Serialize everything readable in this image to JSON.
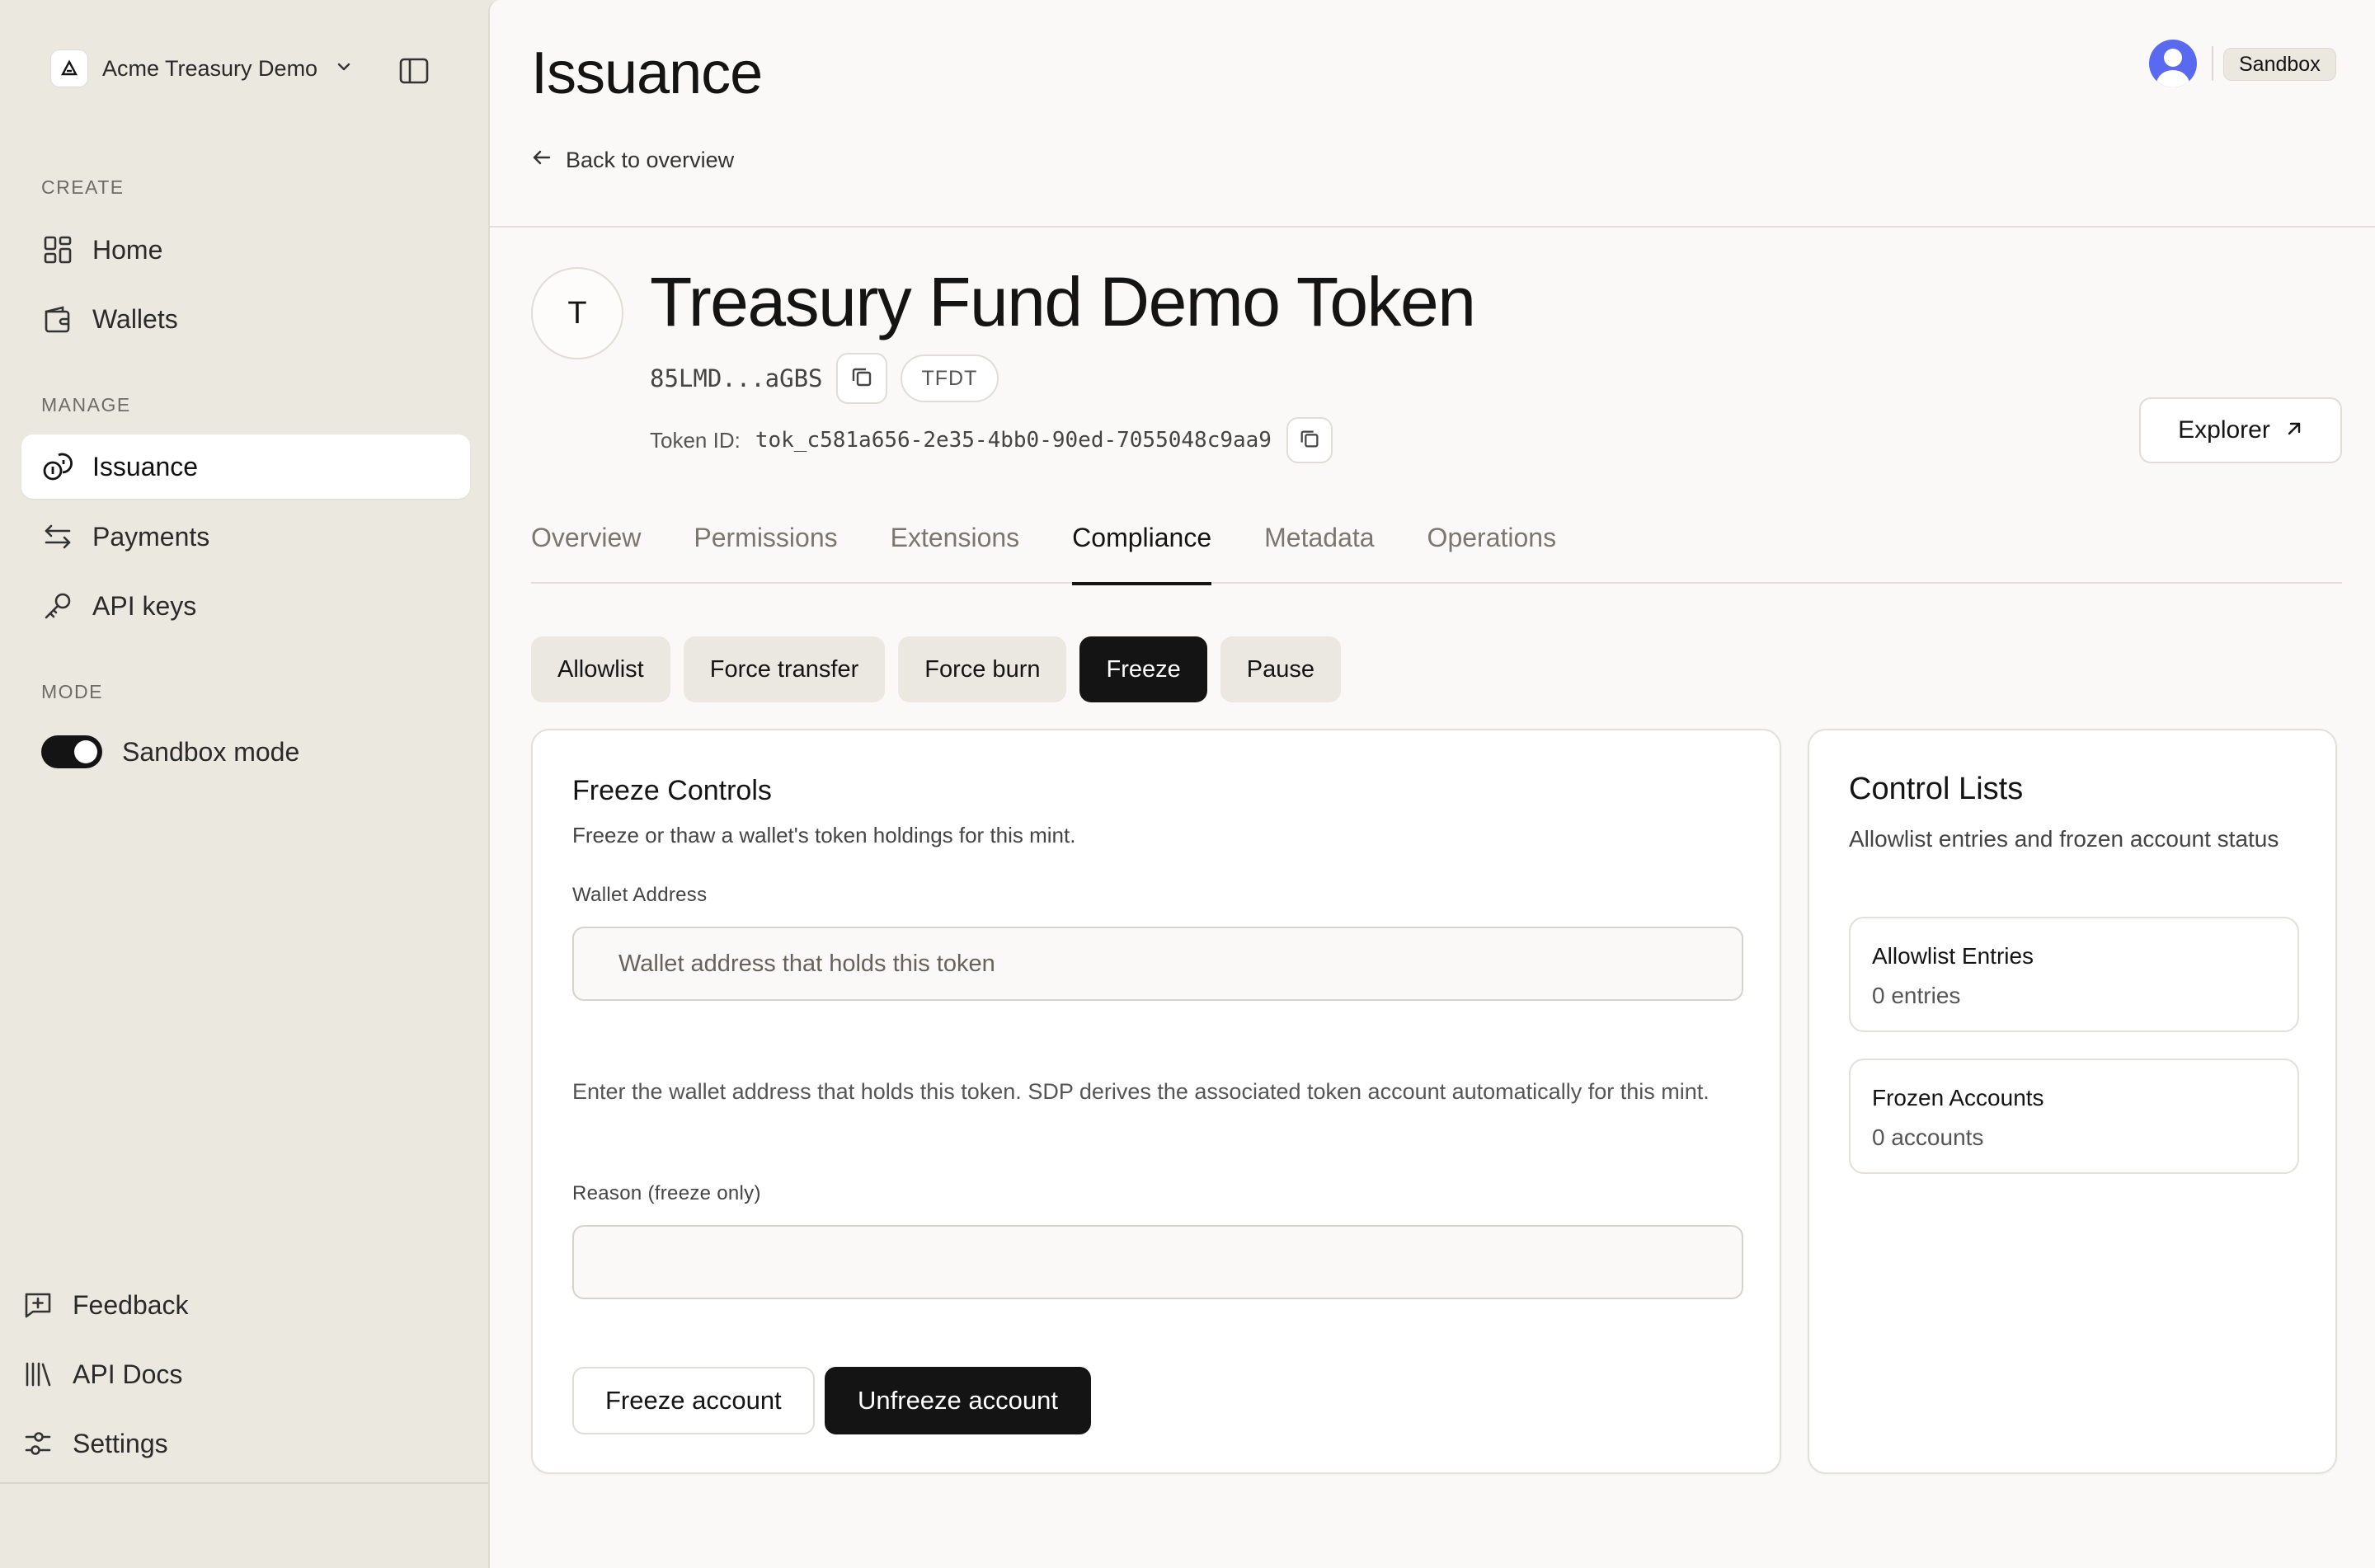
{
  "workspace": {
    "name": "Acme Treasury Demo"
  },
  "sidebar": {
    "sections": [
      {
        "label": "CREATE"
      },
      {
        "label": "MANAGE"
      },
      {
        "label": "MODE"
      }
    ],
    "items": [
      {
        "label": "Home",
        "icon": "grid-icon"
      },
      {
        "label": "Wallets",
        "icon": "wallet-icon"
      },
      {
        "label": "Issuance",
        "icon": "coins-icon",
        "active": true
      },
      {
        "label": "Payments",
        "icon": "arrows-icon"
      },
      {
        "label": "API keys",
        "icon": "key-icon"
      }
    ],
    "mode_toggle": {
      "label": "Sandbox mode",
      "on": true
    },
    "bottom": [
      {
        "label": "Feedback",
        "icon": "feedback-icon"
      },
      {
        "label": "API Docs",
        "icon": "library-icon"
      },
      {
        "label": "Settings",
        "icon": "sliders-icon"
      }
    ]
  },
  "header": {
    "title": "Issuance",
    "back_label": "Back to overview",
    "env_badge": "Sandbox"
  },
  "token": {
    "initial": "T",
    "name": "Treasury Fund Demo Token",
    "address_short": "85LMD...aGBS",
    "symbol": "TFDT",
    "id_label": "Token ID:",
    "id_value": "tok_c581a656-2e35-4bb0-90ed-7055048c9aa9",
    "explorer_label": "Explorer"
  },
  "tabs": [
    {
      "label": "Overview"
    },
    {
      "label": "Permissions"
    },
    {
      "label": "Extensions"
    },
    {
      "label": "Compliance",
      "active": true
    },
    {
      "label": "Metadata"
    },
    {
      "label": "Operations"
    }
  ],
  "compliance_actions": [
    {
      "label": "Allowlist"
    },
    {
      "label": "Force transfer"
    },
    {
      "label": "Force burn"
    },
    {
      "label": "Freeze",
      "active": true
    },
    {
      "label": "Pause"
    }
  ],
  "freeze_card": {
    "title": "Freeze Controls",
    "subtitle": "Freeze or thaw a wallet's token holdings for this mint.",
    "wallet_label": "Wallet Address",
    "wallet_placeholder": "Wallet address that holds this token",
    "wallet_value": "",
    "help_text": "Enter the wallet address that holds this token. SDP derives the associated token account automatically for this mint.",
    "reason_label": "Reason (freeze only)",
    "reason_value": "",
    "freeze_button": "Freeze account",
    "unfreeze_button": "Unfreeze account"
  },
  "control_lists": {
    "title": "Control Lists",
    "subtitle": "Allowlist entries and frozen account status",
    "allowlist": {
      "title": "Allowlist Entries",
      "value": "0 entries"
    },
    "frozen": {
      "title": "Frozen Accounts",
      "value": "0 accounts"
    }
  },
  "colors": {
    "sidebar_bg": "#ebe8e0",
    "main_bg": "#faf9f7",
    "accent_dark": "#141414",
    "avatar": "#5a6af0"
  }
}
